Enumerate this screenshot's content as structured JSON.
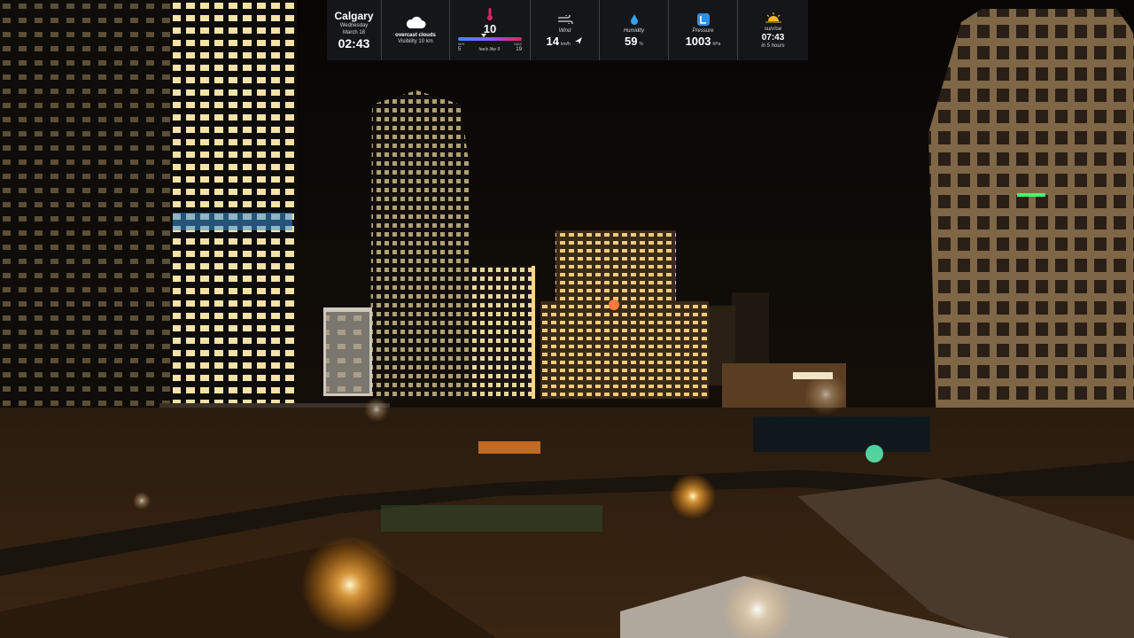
{
  "weather": {
    "city": "Calgary",
    "day": "Wednesday",
    "date": "March 18",
    "time": "02:43",
    "condition": "overcast clouds",
    "visibility": "Visibility 10 km",
    "temp": "10",
    "temp_min_label": "MIN",
    "temp_min": "5",
    "temp_max_label": "MAX",
    "temp_max": "19",
    "feels_like": "feels like 9",
    "wind_label": "Wind",
    "wind_value": "14",
    "wind_unit": "km/h",
    "humidity_label": "Humidity",
    "humidity_value": "59",
    "humidity_unit": "%",
    "pressure_label": "Pressure",
    "pressure_value": "1003",
    "pressure_unit": "hPa",
    "sunrise_label": "sunrise",
    "sunrise_time": "07:43",
    "sunrise_in": "in 5 hours",
    "icons": [
      "cloud-icon",
      "thermometer-icon",
      "wind-icon",
      "droplet-icon",
      "pressure-gauge-icon",
      "sunrise-icon"
    ]
  }
}
